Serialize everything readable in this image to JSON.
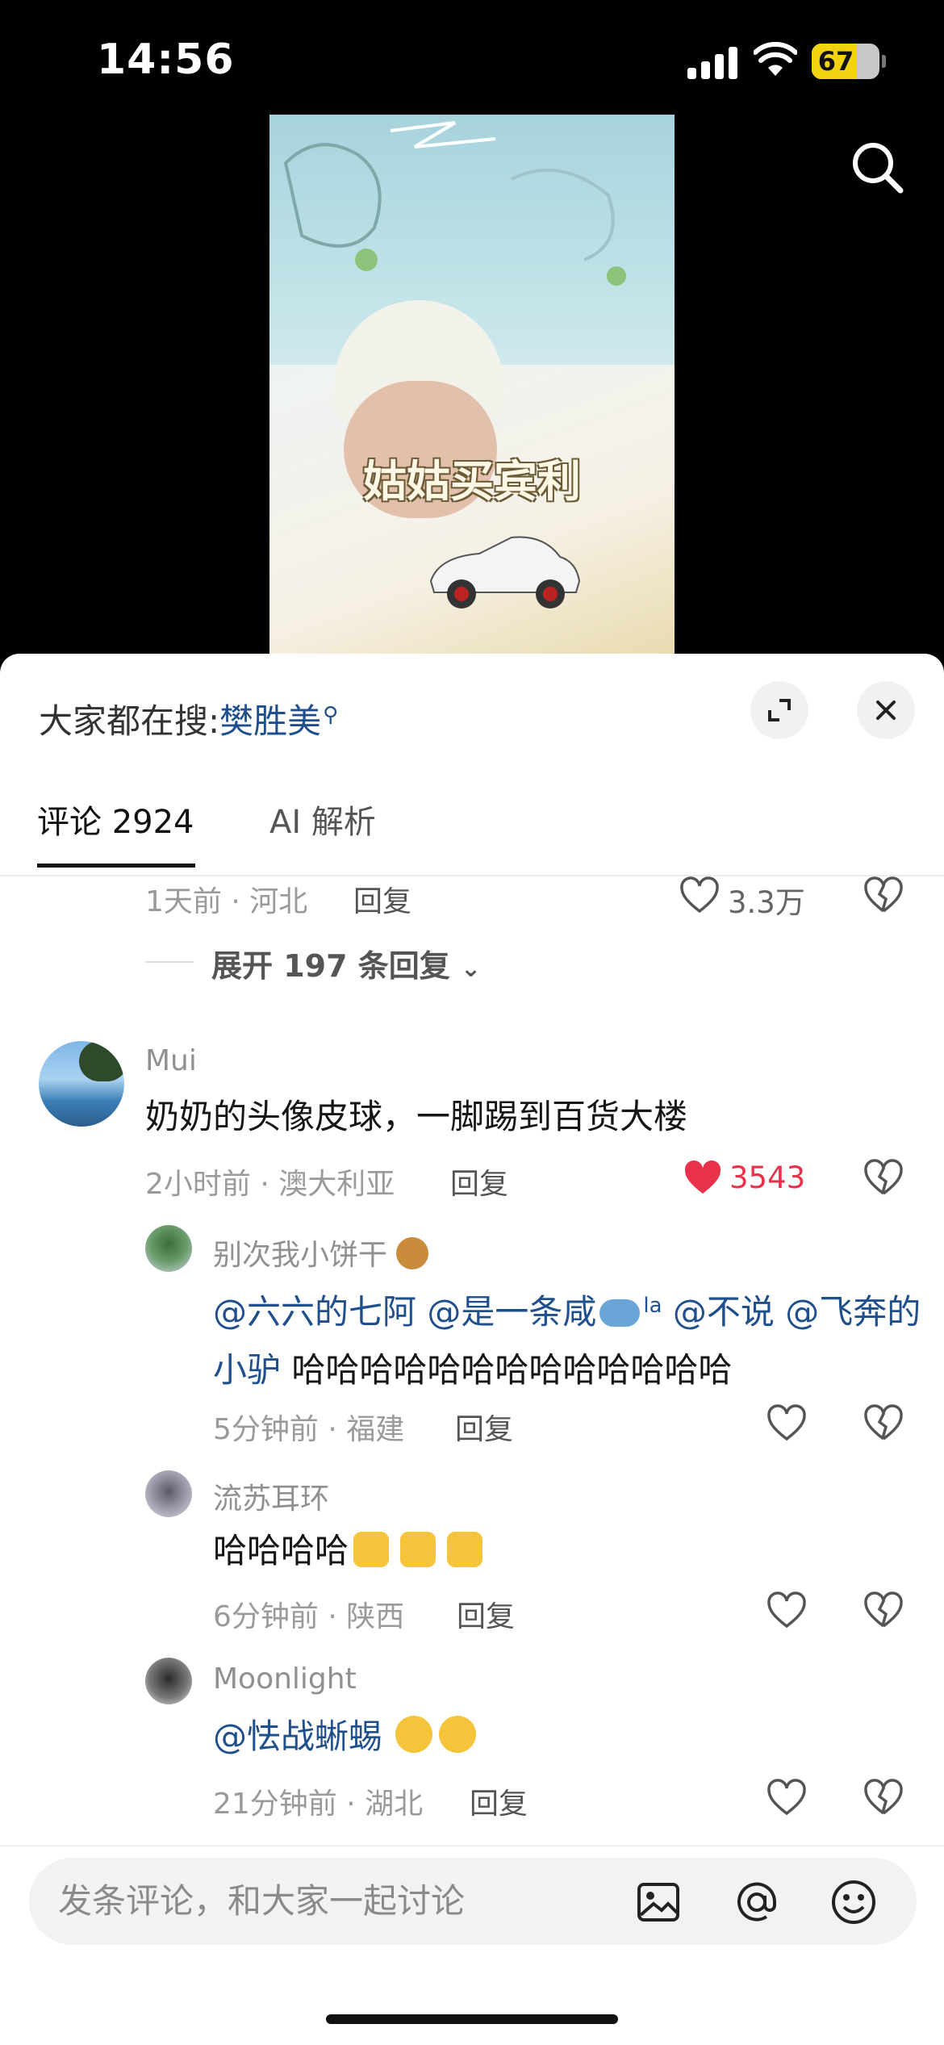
{
  "status_bar": {
    "time": "14:56",
    "battery": "67",
    "battery_level": 0.67
  },
  "video": {
    "caption": "姑姑买宾利"
  },
  "sheet": {
    "trending_label": "大家都在搜:",
    "trending_term": "樊胜美",
    "tabs": [
      {
        "label": "评论 2924",
        "active": true
      },
      {
        "label": "AI 解析",
        "active": false
      }
    ]
  },
  "prev_comment": {
    "meta": "1天前 · 河北",
    "reply": "回复",
    "likes": "3.3万",
    "expand": "展开 197 条回复"
  },
  "comments": [
    {
      "name": "Mui",
      "text": "奶奶的头像皮球，一脚踢到百货大楼",
      "meta": "2小时前 · 澳大利亚",
      "reply": "回复",
      "likes": "3543",
      "liked": true
    },
    {
      "name": "别次我小饼干",
      "mentions": [
        "@六六的七阿",
        "@是一条咸",
        "@不说",
        "@飞奔的小驴"
      ],
      "mention_suffix": "la",
      "text_tail": " 哈哈哈哈哈哈哈哈哈哈哈哈哈",
      "meta": "5分钟前 · 福建",
      "reply": "回复"
    },
    {
      "name": "流苏耳环",
      "text": "哈哈哈哈",
      "meta": "6分钟前 · 陕西",
      "reply": "回复"
    },
    {
      "name": "Moonlight",
      "mention": "@怯战蜥蜴",
      "meta": "21分钟前 · 湖北",
      "reply": "回复"
    }
  ],
  "composer": {
    "placeholder": "发条评论，和大家一起讨论"
  },
  "icons": {
    "search": "search-icon",
    "expand": "expand-icon",
    "close": "close-icon",
    "like": "heart-icon",
    "dislike": "broken-heart-icon",
    "image": "image-icon",
    "at": "at-icon",
    "emoji": "emoji-icon"
  },
  "colors": {
    "mention": "#1f4f8d",
    "liked": "#e8314b",
    "battery": "#f2d30f"
  }
}
